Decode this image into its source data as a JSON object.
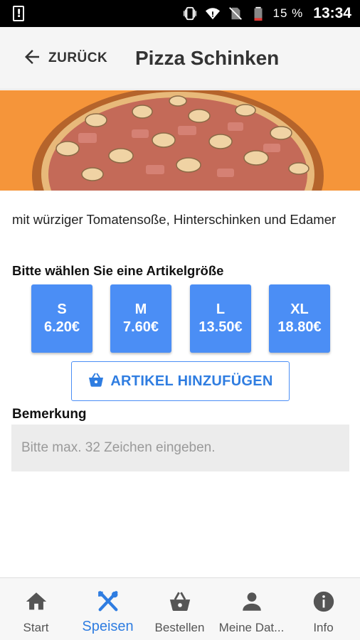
{
  "status_bar": {
    "battery_percent": "15 %",
    "time": "13:34",
    "icons": [
      "alert-icon",
      "vibrate-icon",
      "wifi-icon",
      "no-sim-icon",
      "battery-icon"
    ]
  },
  "header": {
    "back_label": "ZURÜCK",
    "title": "Pizza Schinken"
  },
  "product": {
    "description": "mit würziger Tomatensoße, Hinterschinken und Edamer",
    "size_heading": "Bitte wählen Sie eine Artikelgröße",
    "sizes": [
      {
        "size": "S",
        "price": "6.20€"
      },
      {
        "size": "M",
        "price": "7.60€"
      },
      {
        "size": "L",
        "price": "13.50€"
      },
      {
        "size": "XL",
        "price": "18.80€"
      }
    ],
    "add_button_label": "ARTIKEL HINZUFÜGEN",
    "add_button_icon": "basket-icon"
  },
  "remark": {
    "label": "Bemerkung",
    "placeholder": "Bitte max. 32 Zeichen eingeben.",
    "value": ""
  },
  "bottom_nav": {
    "items": [
      {
        "label": "Start",
        "icon": "home-icon",
        "active": false
      },
      {
        "label": "Speisen",
        "icon": "cutlery-icon",
        "active": true
      },
      {
        "label": "Bestellen",
        "icon": "basket-icon",
        "active": false
      },
      {
        "label": "Meine Dat...",
        "icon": "person-icon",
        "active": false
      },
      {
        "label": "Info",
        "icon": "info-icon",
        "active": false
      }
    ]
  },
  "colors": {
    "accent": "#4b8ef5",
    "accent_text": "#2f7de1",
    "hero_background": "#f5953a",
    "header_background": "#f5f5f5"
  }
}
